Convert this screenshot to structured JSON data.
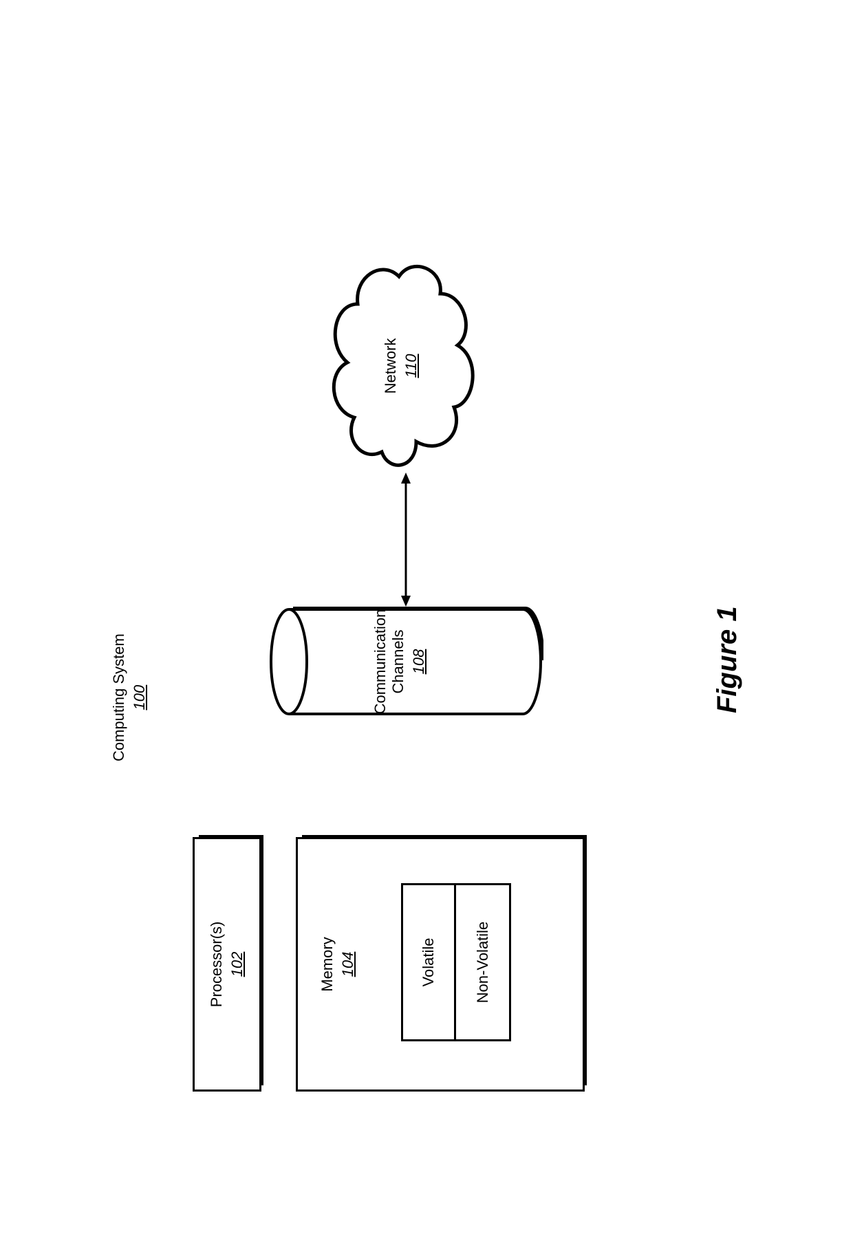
{
  "title": {
    "label": "Computing System",
    "ref": "100"
  },
  "figure_label": "Figure 1",
  "processor": {
    "label": "Processor(s)",
    "ref": "102"
  },
  "memory": {
    "label": "Memory",
    "ref": "104",
    "volatile": "Volatile",
    "nonvolatile": "Non-Volatile"
  },
  "comm": {
    "label1": "Communication",
    "label2": "Channels",
    "ref": "108"
  },
  "network": {
    "label": "Network",
    "ref": "110"
  }
}
